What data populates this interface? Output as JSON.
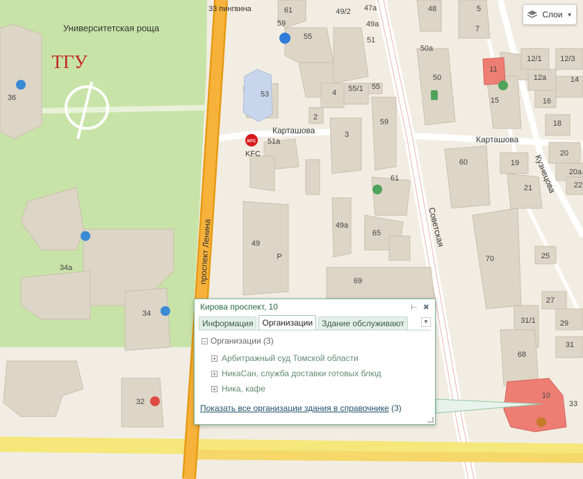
{
  "map": {
    "area_labels": {
      "grove": "Университетская роща",
      "univ": "ТГУ"
    },
    "street_labels": {
      "lenina": "проспект Ленина",
      "kartashova_1": "Карташова",
      "kartashova_2": "Карташова",
      "sovetskaya": "Советская",
      "kuznetsova": "Кузнецова",
      "pingvina": "33 пингвина"
    },
    "poi_labels": {
      "kfc": "KFC",
      "kfc_logo": "KFC"
    },
    "building_numbers": {
      "b36": "36",
      "b34a": "34a",
      "b34": "34",
      "b32": "32",
      "b53": "53",
      "b51a": "51a",
      "b49": "49",
      "p49": "P",
      "b61_top": "61",
      "b59_top": "59",
      "b55_top": "55",
      "b49_2": "49/2",
      "b47a": "47a",
      "b49a_top": "49a",
      "b51": "51",
      "b4": "4",
      "b55_1": "55/1",
      "b55": "55",
      "b2": "2",
      "b3": "3",
      "b59": "59",
      "b61": "61",
      "b49a": "49a",
      "b65": "65",
      "b69": "69",
      "b48": "48",
      "b5": "5",
      "b7": "7",
      "b50a": "50a",
      "b50": "50",
      "b11": "11",
      "b15": "15",
      "b12_1": "12/1",
      "b12_3": "12/3",
      "b12a": "12a",
      "b14": "14",
      "b16": "16",
      "b18": "18",
      "b60": "60",
      "b19": "19",
      "b20": "20",
      "b20a": "20a",
      "b22": "22",
      "b21": "21",
      "b70": "70",
      "b25": "25",
      "b27": "27",
      "b31_1": "31/1",
      "b29": "29",
      "b68": "68",
      "b31": "31",
      "b10": "10",
      "b33": "33"
    },
    "colors": {
      "park": "#c8e3a7",
      "avenue": "#f5a623",
      "avenue_edge": "#e69a14",
      "street": "#ffffff",
      "building": "#ddd5c6",
      "highlight": "#ee7e73"
    }
  },
  "layers_button": {
    "label": "Слои",
    "icon": "layers-icon"
  },
  "popup": {
    "title": "Кирова проспект, 10",
    "tabs": [
      "Информация",
      "Организации",
      "Здание обслуживают"
    ],
    "active_tab": "Организации",
    "root_label": "Организации (3)",
    "orgs": [
      "Арбитражный суд Томской области",
      "НикаСан, служба доставки готовых блюд",
      "Ника, кафе"
    ],
    "footer_link": "Показать все организации здания в справочнике",
    "footer_count": "(3)"
  }
}
